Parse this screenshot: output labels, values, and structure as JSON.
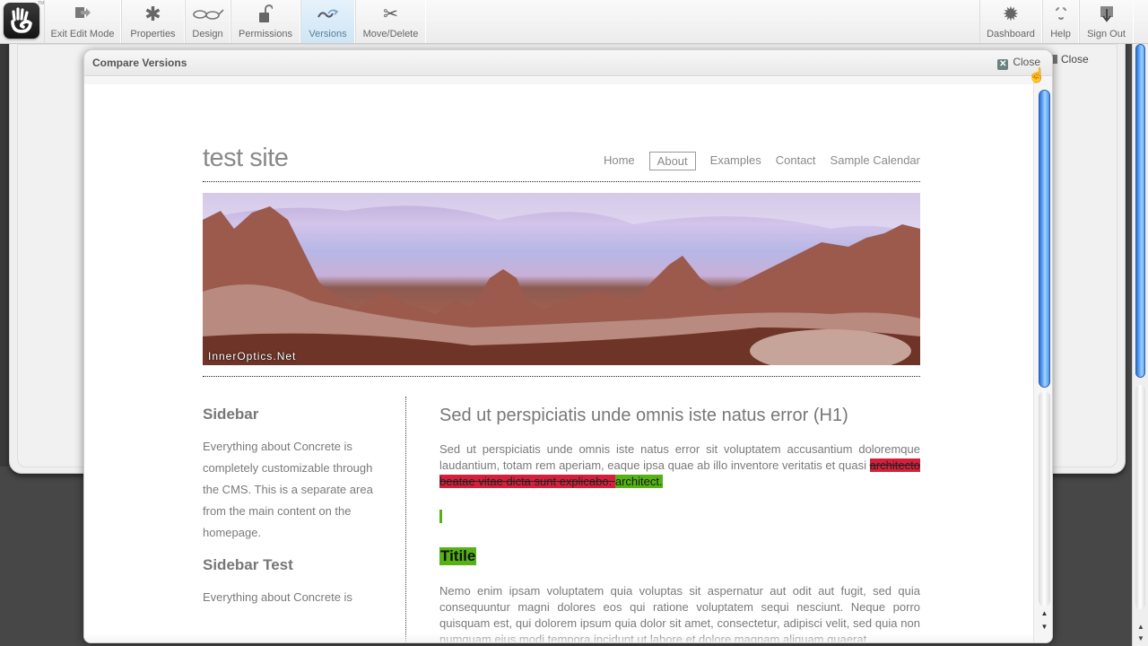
{
  "toolbar": {
    "logo_tm": "TM",
    "left_buttons": [
      {
        "label": "Exit Edit Mode",
        "icon": "exit-edit-icon"
      },
      {
        "label": "Properties",
        "icon": "properties-asterisk-icon"
      },
      {
        "label": "Design",
        "icon": "design-glasses-icon"
      },
      {
        "label": "Permissions",
        "icon": "permissions-padlock-icon"
      },
      {
        "label": "Versions",
        "icon": "versions-icon",
        "active": true
      },
      {
        "label": "Move/Delete",
        "icon": "scissors-icon"
      }
    ],
    "right_buttons": [
      {
        "label": "Dashboard",
        "icon": "dashboard-gear-icon"
      },
      {
        "label": "Help",
        "icon": "help-icon"
      },
      {
        "label": "Sign Out",
        "icon": "sign-out-icon"
      }
    ]
  },
  "background_dialog": {
    "close_label": "Close"
  },
  "dialog": {
    "title": "Compare Versions",
    "close_label": "Close"
  },
  "site": {
    "title": "test site",
    "nav": [
      "Home",
      "About",
      "Examples",
      "Contact",
      "Sample Calendar"
    ],
    "nav_selected": "About",
    "banner_credit": "InnerOptics.Net",
    "sidebar": {
      "heading1": "Sidebar",
      "text1": "Everything about Concrete is completely customizable through the CMS. This is a separate area from the main content on the homepage.",
      "heading2": "Sidebar Test",
      "text2": "Everything about Concrete is"
    },
    "main": {
      "heading": "Sed ut perspiciatis unde omnis iste natus error (H1)",
      "para1_plain": "Sed ut perspiciatis unde omnis iste natus error sit voluptatem accusantium doloremque laudantium, totam rem aperiam, eaque ipsa quae ab illo inventore veritatis et quasi ",
      "para1_deleted": "architecto beatae vitae dicta sunt explicabo. ",
      "para1_inserted": "architect.",
      "inserted_title": "Titile",
      "para2": "Nemo enim ipsam voluptatem quia voluptas sit aspernatur aut odit aut fugit, sed quia consequuntur magni dolores eos qui ratione voluptatem sequi nesciunt. Neque porro quisquam est, qui dolorem ipsum quia dolor sit amet, consectetur, adipisci velit, sed quia non numquam eius modi tempora incidunt ut labore et dolore magnam aliquam quaerat"
    }
  },
  "colors": {
    "deleted_highlight": "#d6203b",
    "inserted_highlight": "#55b215",
    "active_tab": "#cfe5f5",
    "scrollbar_thumb": "#2d6fd6"
  }
}
